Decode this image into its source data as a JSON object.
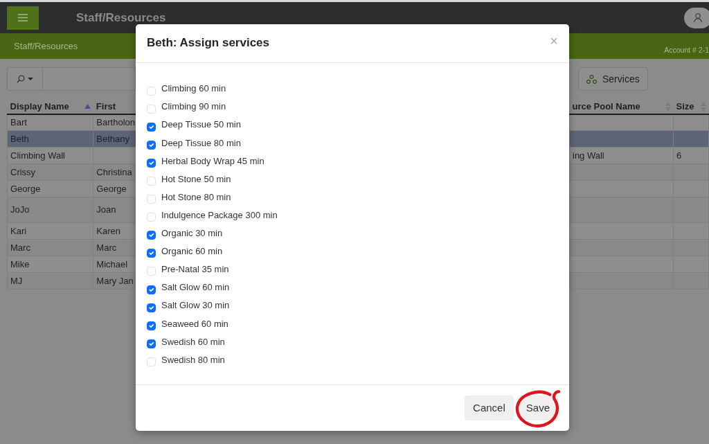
{
  "header": {
    "title": "Staff/Resources"
  },
  "subheader": {
    "breadcrumb": "Staff/Resources",
    "account": "Account # 2-1"
  },
  "toolbar": {
    "services_button": "Services"
  },
  "table_left": {
    "columns": [
      {
        "label": "Display Name",
        "sorted": true,
        "sortable": true
      },
      {
        "label": "First",
        "sortable": false
      }
    ],
    "rows": [
      {
        "cells": [
          "Bart",
          "Bartholon"
        ],
        "selected": false
      },
      {
        "cells": [
          "Beth",
          "Bethany"
        ],
        "selected": true
      },
      {
        "cells": [
          "Climbing Wall",
          null
        ],
        "selected": false
      },
      {
        "cells": [
          "Crissy",
          "Christina"
        ],
        "selected": false
      },
      {
        "cells": [
          "George",
          "George"
        ],
        "selected": false
      },
      {
        "cells": [
          "JoJo",
          "Joan"
        ],
        "selected": false,
        "tall": true
      },
      {
        "cells": [
          "Kari",
          "Karen"
        ],
        "selected": false
      },
      {
        "cells": [
          "Marc",
          "Marc"
        ],
        "selected": false
      },
      {
        "cells": [
          "Mike",
          "Michael"
        ],
        "selected": false
      },
      {
        "cells": [
          "MJ",
          "Mary Jan"
        ],
        "selected": false
      }
    ]
  },
  "table_right": {
    "columns": [
      {
        "label": "urce Pool Name",
        "sorted": false,
        "sortable": true
      },
      {
        "label": "Size",
        "sorted": false,
        "sortable": true
      }
    ],
    "rows": [
      {
        "cells": [
          null,
          null
        ],
        "selected": false
      },
      {
        "cells": [
          null,
          null
        ],
        "selected": true
      },
      {
        "cells": [
          "ing Wall",
          "6"
        ],
        "selected": false
      },
      {
        "cells": [
          null,
          null
        ],
        "selected": false
      },
      {
        "cells": [
          null,
          null
        ],
        "selected": false
      },
      {
        "cells": [
          null,
          null
        ],
        "selected": false,
        "tall": true
      },
      {
        "cells": [
          null,
          null
        ],
        "selected": false
      },
      {
        "cells": [
          null,
          null
        ],
        "selected": false
      },
      {
        "cells": [
          null,
          null
        ],
        "selected": false
      },
      {
        "cells": [
          null,
          null
        ],
        "selected": false
      }
    ]
  },
  "modal": {
    "title": "Beth: Assign services",
    "close": "×",
    "services": [
      {
        "label": "Climbing 60 min",
        "checked": false
      },
      {
        "label": "Climbing 90 min",
        "checked": false
      },
      {
        "label": "Deep Tissue 50 min",
        "checked": true
      },
      {
        "label": "Deep Tissue 80 min",
        "checked": true
      },
      {
        "label": "Herbal Body Wrap 45 min",
        "checked": true
      },
      {
        "label": "Hot Stone 50 min",
        "checked": false
      },
      {
        "label": "Hot Stone 80 min",
        "checked": false
      },
      {
        "label": "Indulgence Package 300 min",
        "checked": false
      },
      {
        "label": "Organic 30 min",
        "checked": true
      },
      {
        "label": "Organic 60 min",
        "checked": true
      },
      {
        "label": "Pre-Natal 35 min",
        "checked": false
      },
      {
        "label": "Salt Glow 60 min",
        "checked": true
      },
      {
        "label": "Salt Glow 30 min",
        "checked": true
      },
      {
        "label": "Seaweed 60 min",
        "checked": true
      },
      {
        "label": "Swedish 60 min",
        "checked": true
      },
      {
        "label": "Swedish 80 min",
        "checked": false
      }
    ],
    "buttons": [
      {
        "label": "Cancel",
        "circled": false
      },
      {
        "label": "Save",
        "circled": true
      }
    ]
  }
}
